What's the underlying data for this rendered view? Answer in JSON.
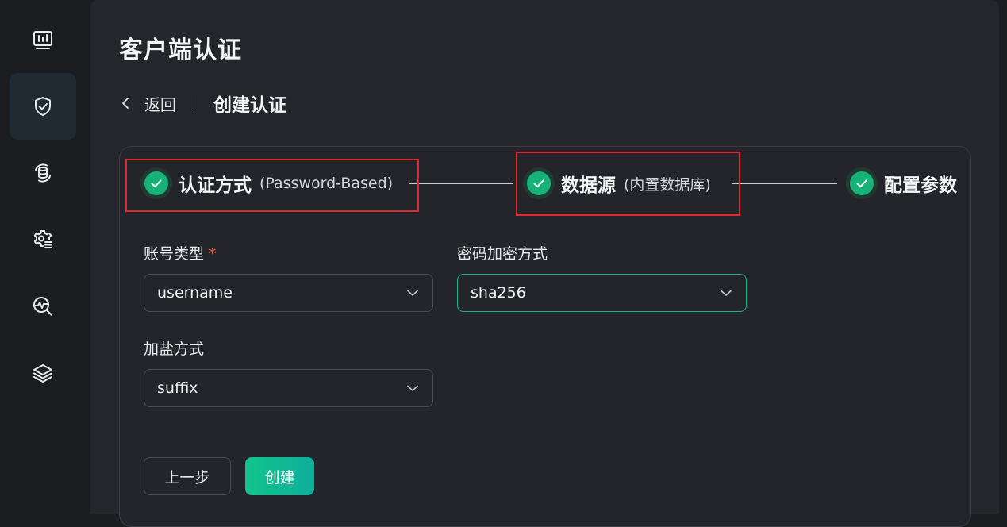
{
  "sidebar": {
    "items": [
      {
        "icon": "dashboard-monitor-icon",
        "active": false
      },
      {
        "icon": "shield-check-icon",
        "active": true
      },
      {
        "icon": "database-sync-icon",
        "active": false
      },
      {
        "icon": "gear-list-icon",
        "active": false
      },
      {
        "icon": "pulse-search-icon",
        "active": false
      },
      {
        "icon": "layers-icon",
        "active": false
      }
    ]
  },
  "page": {
    "title": "客户端认证",
    "back_label": "返回",
    "breadcrumb_title": "创建认证"
  },
  "steps": [
    {
      "label": "认证方式",
      "sub": "(Password-Based)",
      "status": "done"
    },
    {
      "label": "数据源",
      "sub": "(内置数据库)",
      "status": "done"
    },
    {
      "label": "配置参数",
      "sub": "",
      "status": "done"
    }
  ],
  "form": {
    "account_type": {
      "label": "账号类型",
      "required_mark": "*",
      "value": "username"
    },
    "password_hash": {
      "label": "密码加密方式",
      "value": "sha256"
    },
    "salt_position": {
      "label": "加盐方式",
      "value": "suffix"
    }
  },
  "actions": {
    "prev_label": "上一步",
    "create_label": "创建"
  },
  "colors": {
    "accent": "#17b27a",
    "highlight": "#e0282e",
    "required": "#ff5a3c"
  }
}
